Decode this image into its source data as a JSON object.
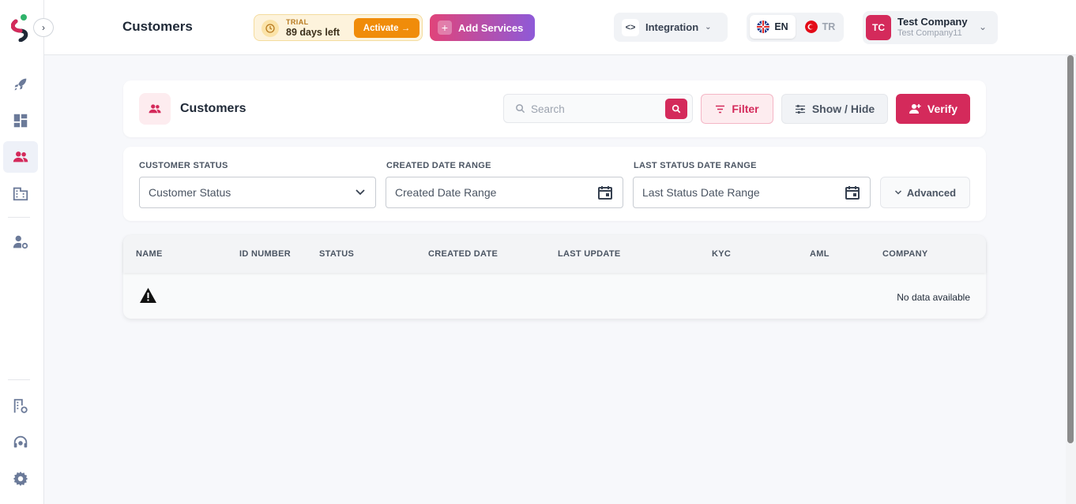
{
  "header": {
    "page_title": "Customers",
    "trial": {
      "label": "TRIAL",
      "days_left": "89 days left",
      "activate_label": "Activate →"
    },
    "add_services_label": "Add Services",
    "integration_label": "Integration",
    "languages": [
      {
        "code": "EN",
        "active": true
      },
      {
        "code": "TR",
        "active": false
      }
    ],
    "user": {
      "initials": "TC",
      "name": "Test Company",
      "sub": "Test Company11"
    }
  },
  "sidebar": {
    "items": [
      {
        "name": "rocket-icon",
        "active": false
      },
      {
        "name": "dashboard-icon",
        "active": false
      },
      {
        "name": "customers-icon",
        "active": true
      },
      {
        "name": "building-icon",
        "active": false
      },
      {
        "name": "user-settings-icon",
        "active": false
      },
      {
        "name": "building-settings-icon",
        "active": false
      },
      {
        "name": "support-agent-icon",
        "active": false
      },
      {
        "name": "gear-icon",
        "active": false
      }
    ]
  },
  "main": {
    "card_title": "Customers",
    "search_placeholder": "Search",
    "filter_label": "Filter",
    "show_hide_label": "Show / Hide",
    "verify_label": "Verify",
    "filters": {
      "customer_status_label": "CUSTOMER STATUS",
      "customer_status_value": "Customer Status",
      "created_date_label": "CREATED DATE RANGE",
      "created_date_value": "Created Date Range",
      "last_status_label": "LAST STATUS DATE RANGE",
      "last_status_value": "Last Status Date Range",
      "advanced_label": "Advanced"
    },
    "table": {
      "columns": [
        "NAME",
        "ID NUMBER",
        "STATUS",
        "CREATED DATE",
        "LAST UPDATE",
        "KYC",
        "AML",
        "COMPANY"
      ],
      "empty_text": "No data available"
    }
  },
  "colors": {
    "primary": "#d42a5b",
    "trial_accent": "#f08c0a",
    "gradient_start": "#e0447a",
    "gradient_end": "#8e5ad8"
  }
}
